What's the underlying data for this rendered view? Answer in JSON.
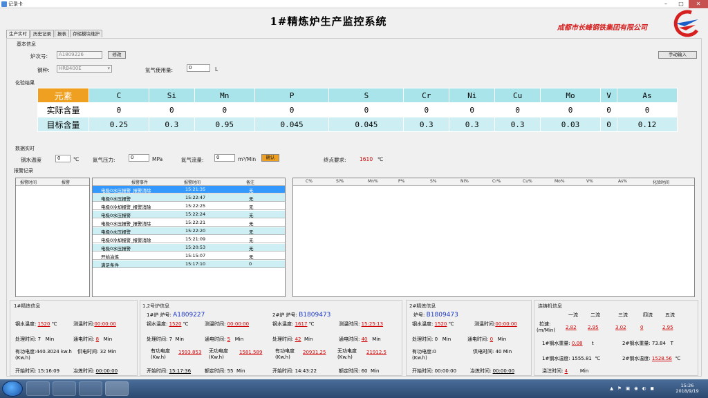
{
  "window": {
    "title": "记录卡"
  },
  "header": {
    "title": "1#精炼炉生产监控系统",
    "company": "成都市长峰钢铁集团有限公司"
  },
  "tabs": [
    "生产实时",
    "历史记录",
    "报表",
    "存储模块维护"
  ],
  "basic": {
    "section": "基本信息",
    "furnace_label": "炉次号:",
    "furnace_value": "A1809226",
    "modify_btn": "修改",
    "steel_label": "钢种:",
    "steel_value": "HRB400E",
    "argon_label": "氩气使用量:",
    "argon_value": "0",
    "argon_unit": "L",
    "manual_btn": "手动输入"
  },
  "chem": {
    "section": "化验结果",
    "header_label": "元素",
    "elements": [
      "C",
      "Si",
      "Mn",
      "P",
      "S",
      "Cr",
      "Ni",
      "Cu",
      "Mo",
      "V",
      "As"
    ],
    "actual_label": "实际含量",
    "actual": [
      "0",
      "0",
      "0",
      "0",
      "0",
      "0",
      "0",
      "0",
      "0",
      "0",
      "0"
    ],
    "target_label": "目标含量",
    "target": [
      "0.25",
      "0.3",
      "0.95",
      "0.045",
      "0.045",
      "0.3",
      "0.3",
      "0.3",
      "0.03",
      "0",
      "0.12"
    ]
  },
  "monitor": {
    "section": "数据实时",
    "water_label": "钢水温度",
    "water_value": "0",
    "water_unit": "℃",
    "ngas_label": "氮气压力:",
    "ngas_value": "0",
    "ngas_unit": "MPa",
    "nflow_label": "氮气流量:",
    "nflow_value": "0",
    "nflow_unit": "m³/Min",
    "confirm_btn": "确认",
    "target_label": "终点要求:",
    "target_value": "1610",
    "target_unit": "℃"
  },
  "alarm": {
    "section": "报警记录",
    "left_cols": [
      "报警时间",
      "报警"
    ],
    "mid_cols": [
      "报警事件",
      "报警时间",
      "备注"
    ],
    "rows": [
      {
        "event": "电极0水压报警_报警消除",
        "time": "15:21:35",
        "note": "无"
      },
      {
        "event": "电极0水压报警",
        "time": "15:22:47",
        "note": "无"
      },
      {
        "event": "电极0冷却报警_报警消除",
        "time": "15:22:25",
        "note": "无"
      },
      {
        "event": "电极0水压报警",
        "time": "15:22:24",
        "note": "无"
      },
      {
        "event": "电极0水压报警_报警消除",
        "time": "15:22:21",
        "note": "无"
      },
      {
        "event": "电极0水压报警",
        "time": "15:22:20",
        "note": "无"
      },
      {
        "event": "电极0冷却报警_报警消除",
        "time": "15:21:09",
        "note": "无"
      },
      {
        "event": "电极0水压报警",
        "time": "15:20:53",
        "note": "无"
      },
      {
        "event": "开始冶炼",
        "time": "15:15:07",
        "note": "无"
      },
      {
        "event": "满足条件",
        "time": "15:17:10",
        "note": "0"
      }
    ],
    "right_cols": [
      "C%",
      "Si%",
      "Mn%",
      "P%",
      "S%",
      "Ni%",
      "Cr%",
      "Cu%",
      "Mo%",
      "V%",
      "As%",
      "化验时间"
    ]
  },
  "p1": {
    "section": "1#精炼信息",
    "temp_label": "钢水温度:",
    "temp_value": "1520",
    "temp_unit": "℃",
    "measure_label": "测温时间:",
    "measure_value": "00:00:00",
    "proc_label": "处理时间:",
    "proc_value": "7",
    "proc_unit": "Min",
    "feed_label": "通电时间:",
    "feed_value": "8",
    "feed_unit": "Min",
    "power_label": "有功电度:",
    "power_value": "440.3024",
    "power_unit": "kw.h",
    "power2_label": "(Kw.h)",
    "elec_label": "供电时间:",
    "elec_value": "32",
    "elec_unit": "Min",
    "start_label": "开始时间:",
    "start_value": "15:16:09",
    "end_label": "冶炼时间:",
    "end_value": "00:00:00"
  },
  "p2": {
    "section": "1,2号炉信息",
    "left": {
      "furnace_label": "1#炉 炉号:",
      "furnace_value": "A1809227",
      "temp_label": "钢水温度:",
      "temp_value": "1520",
      "temp_unit": "℃",
      "measure_label": "测温时间:",
      "measure_value": "00:00:00",
      "proc_label": "处理时间:",
      "proc_value": "7",
      "proc_unit": "Min",
      "feed_label": "通电时间:",
      "feed_value": "5",
      "feed_unit": "Min",
      "power_label": "有功电度",
      "power_unit": "(Kw.h)",
      "power_value": "1593.853",
      "npower_label": "无功电度",
      "npower_unit": "(Kw.h)",
      "npower_value": "1581.589",
      "start_label": "开始时间:",
      "start_value": "15:17:36",
      "end_label": "额定时间:",
      "end_value": "55",
      "end_unit": "Min"
    },
    "right": {
      "furnace_label": "2#炉 炉号:",
      "furnace_value": "B1809473",
      "temp_label": "钢水温度:",
      "temp_value": "1617",
      "temp_unit": "℃",
      "measure_label": "测温时间:",
      "measure_value": "15:25:13",
      "proc_label": "处理时间:",
      "proc_value": "42",
      "proc_unit": "Min",
      "feed_label": "通电时间:",
      "feed_value": "40",
      "feed_unit": "Min",
      "power_label": "有功电度",
      "power_unit": "(Kw.h)",
      "power_value": "20931.25",
      "npower_label": "无功电度",
      "npower_unit": "(Kw.h)",
      "npower_value": "21912.5",
      "start_label": "开始时间:",
      "start_value": "14:43:22",
      "end_label": "额定时间:",
      "end_value": "60",
      "end_unit": "Min"
    }
  },
  "p3": {
    "section": "2#精炼信息",
    "furnace_label": "炉号:",
    "furnace_value": "B1809473",
    "temp_label": "钢水温度:",
    "temp_value": "1520",
    "temp_unit": "℃",
    "measure_label": "测温时间:",
    "measure_value": "00:00:00",
    "proc_label": "处理时间:",
    "proc_value": "0",
    "proc_unit": "Min",
    "feed_label": "通电时间:",
    "feed_value": "0",
    "feed_unit": "Min",
    "power_label": "有功电度:",
    "power_value": "0",
    "power_unit": "(Kw.h)",
    "elec_label": "供电时间:",
    "elec_value": "40",
    "elec_unit": "Min",
    "start_label": "开始时间:",
    "start_value": "00:00:00",
    "end_label": "冶炼时间:",
    "end_value": "00:00:00"
  },
  "p4": {
    "section": "连铸机信息",
    "cols": [
      "一流",
      "二流",
      "三流",
      "四流",
      "五流"
    ],
    "speed_label": "拉速:",
    "speed_unit": "(m/Min)",
    "speed_values": [
      "2.82",
      "2.95",
      "3.02",
      "0",
      "2.95"
    ],
    "steel_label": "1#钢水重量:",
    "steel_value": "0.08",
    "steel_unit": "t",
    "steel2_label": "2#钢水重量:",
    "steel2_value": "73.84",
    "steel2_unit": "T",
    "temp1_label": "1#钢水温度:",
    "temp1_value": "1555.81",
    "temp1_unit": "℃",
    "temp2_label": "2#钢水温度:",
    "temp2_value": "1528.56",
    "temp2_unit": "℃",
    "pour_label": "浇注时间:",
    "pour_value": "4",
    "pour_unit": "Min"
  },
  "taskbar": {
    "time": "15:26",
    "date": "2018/9/19"
  }
}
